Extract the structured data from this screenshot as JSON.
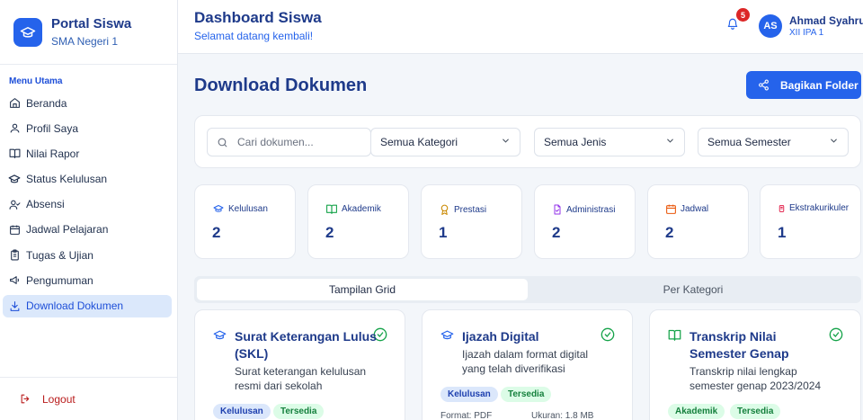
{
  "brand": {
    "title": "Portal Siswa",
    "subtitle": "SMA Negeri 1"
  },
  "sidebar": {
    "heading": "Menu Utama",
    "items": [
      {
        "label": "Beranda",
        "icon": "home-icon"
      },
      {
        "label": "Profil Saya",
        "icon": "user-icon"
      },
      {
        "label": "Nilai Rapor",
        "icon": "book-open-icon"
      },
      {
        "label": "Status Kelulusan",
        "icon": "graduation-cap-icon"
      },
      {
        "label": "Absensi",
        "icon": "user-check-icon"
      },
      {
        "label": "Jadwal Pelajaran",
        "icon": "calendar-icon"
      },
      {
        "label": "Tugas & Ujian",
        "icon": "clipboard-icon"
      },
      {
        "label": "Pengumuman",
        "icon": "megaphone-icon"
      },
      {
        "label": "Download Dokumen",
        "icon": "download-icon",
        "active": true
      }
    ],
    "logout_label": "Logout"
  },
  "header": {
    "title": "Dashboard Siswa",
    "subtitle": "Selamat datang kembali!",
    "notification_count": "5",
    "user_initials": "AS",
    "user_name": "Ahmad Syahrul",
    "user_class": "XII IPA 1"
  },
  "main": {
    "title": "Download Dokumen",
    "share_label": "Bagikan Folder",
    "search_placeholder": "Cari dokumen...",
    "filters": {
      "kategori": "Semua Kategori",
      "jenis": "Semua Jenis",
      "semester": "Semua Semester"
    },
    "stats": [
      {
        "label": "Kelulusan",
        "value": "2",
        "icon": "graduation-cap-icon",
        "color": "#2563eb"
      },
      {
        "label": "Akademik",
        "value": "2",
        "icon": "book-open-icon",
        "color": "#16a34a"
      },
      {
        "label": "Prestasi",
        "value": "1",
        "icon": "award-icon",
        "color": "#ca8a04"
      },
      {
        "label": "Administrasi",
        "value": "2",
        "icon": "file-check-icon",
        "color": "#9333ea"
      },
      {
        "label": "Jadwal",
        "value": "2",
        "icon": "calendar-icon",
        "color": "#ea580c"
      },
      {
        "label": "Ekstrakurikuler",
        "value": "1",
        "icon": "trophy-icon",
        "color": "#e11d48"
      }
    ],
    "tabs": [
      {
        "label": "Tampilan Grid"
      },
      {
        "label": "Per Kategori"
      }
    ],
    "documents": [
      {
        "title": "Surat Keterangan Lulus (SKL)",
        "description": "Surat keterangan kelulusan resmi dari sekolah",
        "category": "Kelulusan",
        "status": "Tersedia",
        "icon": "graduation-cap-icon"
      },
      {
        "title": "Ijazah Digital",
        "description": "Ijazah dalam format digital yang telah diverifikasi",
        "category": "Kelulusan",
        "status": "Tersedia",
        "format": "Format: PDF",
        "size": "Ukuran: 1.8 MB",
        "icon": "graduation-cap-icon"
      },
      {
        "title": "Transkrip Nilai Semester Genap",
        "description": "Transkrip nilai lengkap semester genap 2023/2024",
        "category": "Akademik",
        "status": "Tersedia",
        "icon": "book-open-icon"
      }
    ]
  }
}
